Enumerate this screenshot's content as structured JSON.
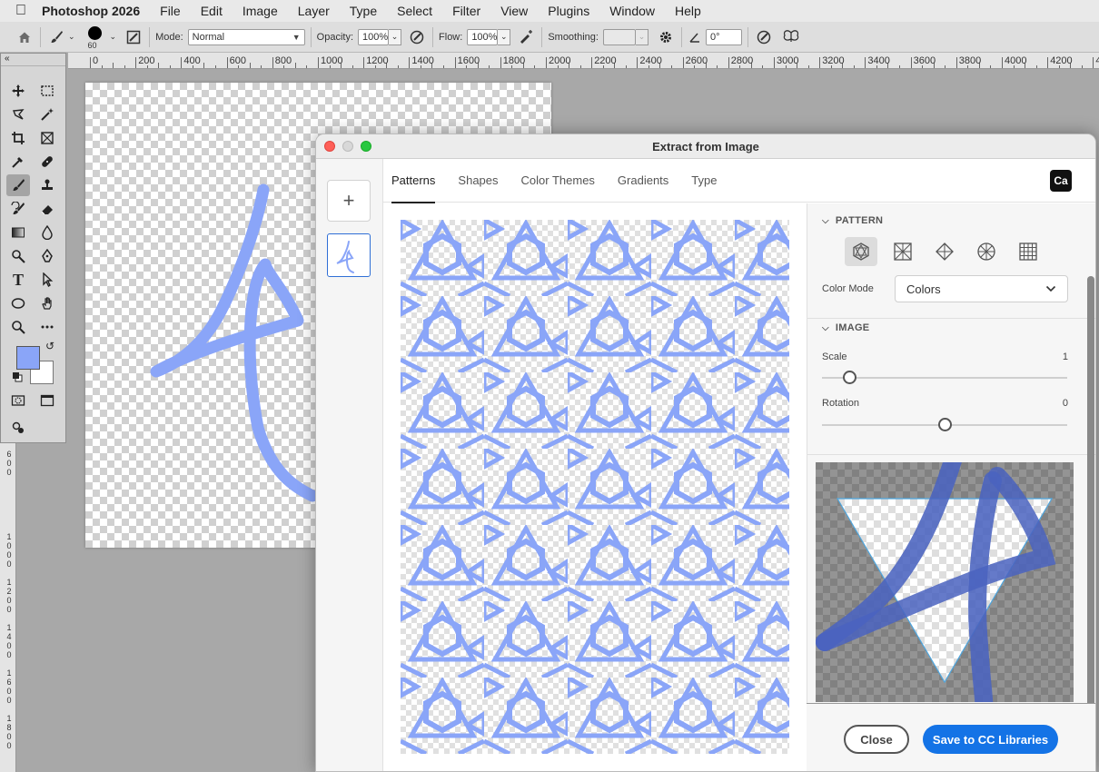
{
  "menubar": {
    "app_name": "Photoshop 2026",
    "items": [
      "File",
      "Edit",
      "Image",
      "Layer",
      "Type",
      "Select",
      "Filter",
      "View",
      "Plugins",
      "Window",
      "Help"
    ]
  },
  "options_bar": {
    "brush_size": "60",
    "mode_label": "Mode:",
    "mode_value": "Normal",
    "opacity_label": "Opacity:",
    "opacity_value": "100%",
    "flow_label": "Flow:",
    "flow_value": "100%",
    "smoothing_label": "Smoothing:",
    "smoothing_value": "",
    "angle_value": "0°"
  },
  "ruler": {
    "top_labels": [
      "0",
      "200",
      "400",
      "600",
      "800",
      "1000",
      "1200",
      "1400",
      "1600",
      "1800",
      "2000",
      "2200",
      "2400",
      "2600",
      "2800",
      "3000",
      "3200",
      "3400",
      "3600",
      "3800",
      "4000",
      "4200",
      "440"
    ],
    "left_labels": [
      [
        "6",
        "0",
        "0"
      ],
      [
        "1",
        "0",
        "0",
        "0"
      ],
      [
        "1",
        "2",
        "0",
        "0"
      ],
      [
        "1",
        "4",
        "0",
        "0"
      ],
      [
        "1",
        "6",
        "0",
        "0"
      ],
      [
        "1",
        "8",
        "0",
        "0"
      ]
    ]
  },
  "colors": {
    "foreground": "#8aa5f8",
    "background": "#ffffff",
    "stroke": "#8aa5f8",
    "accent": "#1473e6"
  },
  "dialog": {
    "title": "Extract from Image",
    "add_label": "+",
    "tabs": [
      "Patterns",
      "Shapes",
      "Color Themes",
      "Gradients",
      "Type"
    ],
    "active_tab": "Patterns",
    "badge": "Ca",
    "pattern_section": "PATTERN",
    "pattern_types": [
      "hexagon-star-icon",
      "square-grid-diagonal-icon",
      "diamond-icon",
      "star-circle-icon",
      "square-grid-icon"
    ],
    "color_mode_label": "Color Mode",
    "color_mode_value": "Colors",
    "image_section": "IMAGE",
    "scale_label": "Scale",
    "scale_value": "1",
    "rotation_label": "Rotation",
    "rotation_value": "0",
    "close_label": "Close",
    "save_label": "Save to CC Libraries"
  }
}
